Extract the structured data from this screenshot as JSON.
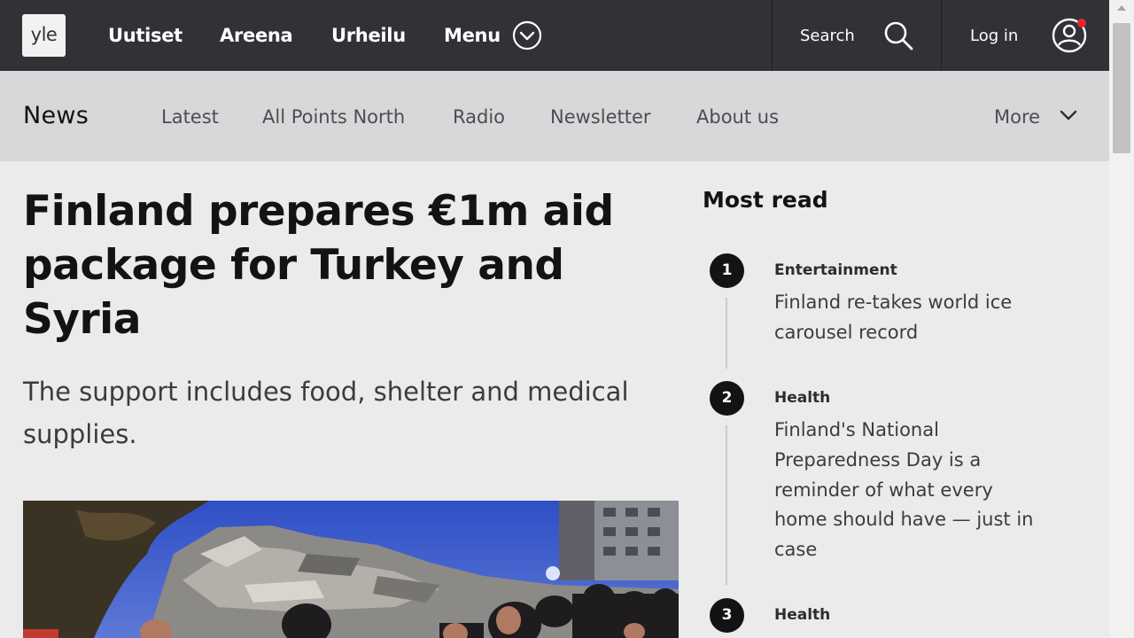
{
  "topbar": {
    "logo": "yle",
    "nav": [
      "Uutiset",
      "Areena",
      "Urheilu"
    ],
    "menu_label": "Menu",
    "search_label": "Search",
    "login_label": "Log in",
    "background": "#303236",
    "notification_color": "#e8212f"
  },
  "subnav": {
    "title": "News",
    "items": [
      "Latest",
      "All Points North",
      "Radio",
      "Newsletter",
      "About us"
    ],
    "more_label": "More"
  },
  "article": {
    "headline": "Finland prepares €1m aid package for Turkey and Syria",
    "lead": "The support includes food, shelter and medical supplies.",
    "image_alt": "earthquake-rubble-rescue-photo"
  },
  "most_read": {
    "title": "Most read",
    "items": [
      {
        "rank": "1",
        "category": "Entertainment",
        "title": "Finland re-takes world ice carousel record"
      },
      {
        "rank": "2",
        "category": "Health",
        "title": "Finland's National Preparedness Day is a reminder of what every home should have — just in case"
      },
      {
        "rank": "3",
        "category": "Health",
        "title": ""
      }
    ]
  },
  "icons": {
    "menu": "chevron-down-circle-icon",
    "search": "search-icon",
    "user": "user-circle-icon",
    "more": "chevron-down-icon"
  }
}
